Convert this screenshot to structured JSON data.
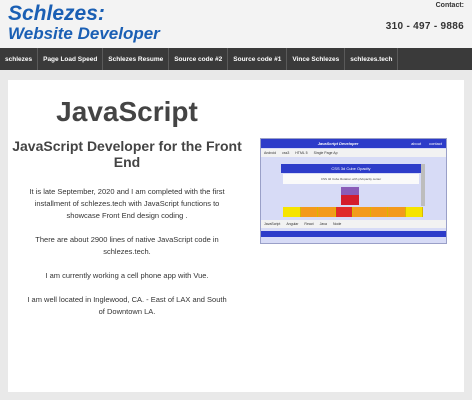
{
  "header": {
    "logo_line1": "Schlezes:",
    "logo_line2": "Website Developer",
    "contact_label": "Contact:",
    "phone": "310 - 497 - 9886"
  },
  "nav": {
    "items": [
      "schlezes",
      "Page Load Speed",
      "Schlezes Resume",
      "Source code #2",
      "Source code #1",
      "Vince Schlezes",
      "schlezes.tech"
    ]
  },
  "main": {
    "title": "JavaScript",
    "subtitle": "JavaScript Developer for the Front End",
    "paragraphs": [
      "It is late September, 2020 and I am completed with the first installment of  schlezes.tech with JavaScript functions to showcase Front End design coding .",
      "There are about 2900 lines of native JavaScript code in schlezes.tech.",
      "I am currently working a cell phone app with Vue.",
      "I am well located in Inglewood, CA. - East of LAX and South of Downtown LA."
    ]
  },
  "preview": {
    "title": "JavaScript Developer",
    "top_links": [
      "about",
      "contact"
    ],
    "nav_items": [
      "Android",
      "css3",
      "HTML 5",
      "Single Page Ap"
    ],
    "bar_text": "CSS 3d Cube Opacity",
    "panel_text": "CSS 3d Cube Rotation with ph/opacity center",
    "footer_items": [
      "JavaScript",
      "Angular",
      "React",
      "Java",
      "Node"
    ]
  },
  "colors": {
    "brand_blue": "#1a5fb4",
    "nav_bg": "#3a3a3a",
    "preview_blue": "#2d3cc9"
  }
}
